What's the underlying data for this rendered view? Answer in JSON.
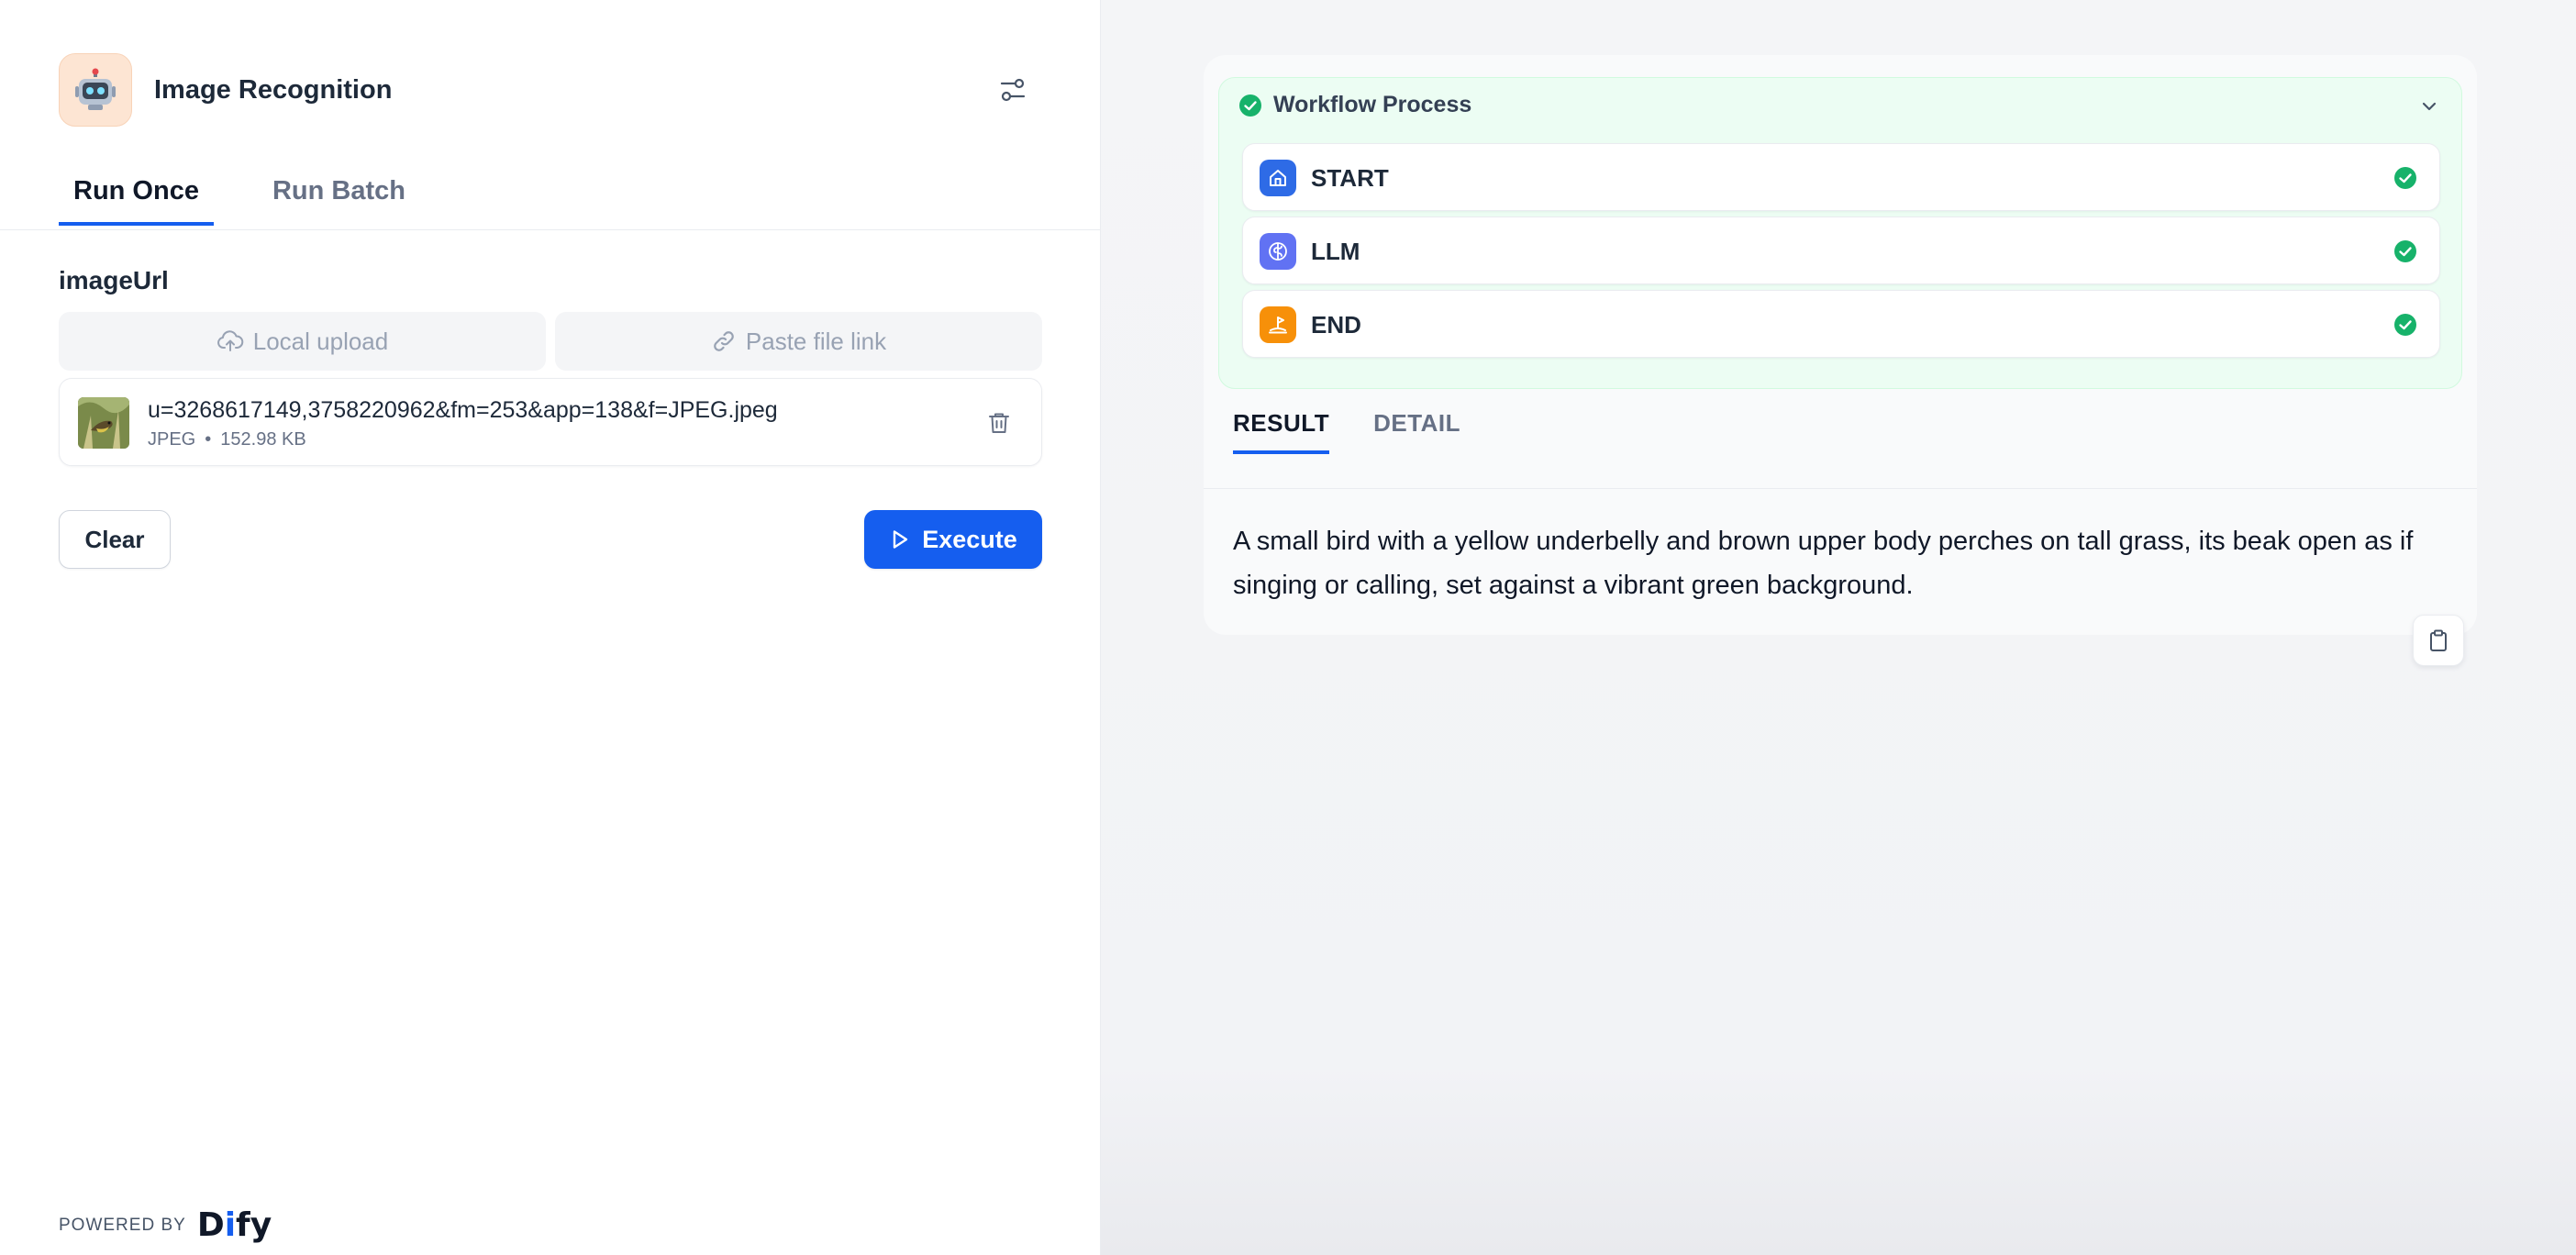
{
  "app": {
    "title": "Image Recognition",
    "icon": "robot-icon"
  },
  "tabs": [
    {
      "label": "Run Once",
      "active": true
    },
    {
      "label": "Run Batch",
      "active": false
    }
  ],
  "form": {
    "field_label": "imageUrl",
    "local_upload_label": "Local upload",
    "paste_link_label": "Paste file link",
    "file": {
      "name": "u=3268617149,3758220962&fm=253&app=138&f=JPEG.jpeg",
      "type": "JPEG",
      "separator": "•",
      "size": "152.98 KB"
    },
    "clear_label": "Clear",
    "execute_label": "Execute"
  },
  "footer": {
    "powered_by": "POWERED BY",
    "brand_d": "D",
    "brand_i": "i",
    "brand_rest": "fy"
  },
  "workflow": {
    "title": "Workflow Process",
    "status": "success",
    "nodes": [
      {
        "label": "START",
        "icon": "home-icon",
        "color": "#2e6be6"
      },
      {
        "label": "LLM",
        "icon": "brain-icon",
        "color": "#6172f3"
      },
      {
        "label": "END",
        "icon": "flag-icon",
        "color": "#f79009"
      }
    ]
  },
  "result": {
    "tabs": [
      {
        "label": "RESULT",
        "active": true
      },
      {
        "label": "DETAIL",
        "active": false
      }
    ],
    "text": "A small bird with a yellow underbelly and brown upper body perches on tall grass, its beak open as if singing or calling, set against a vibrant green background."
  },
  "colors": {
    "accent": "#155eef",
    "success": "#17b26a",
    "workflow_bg": "#ecfdf3"
  }
}
